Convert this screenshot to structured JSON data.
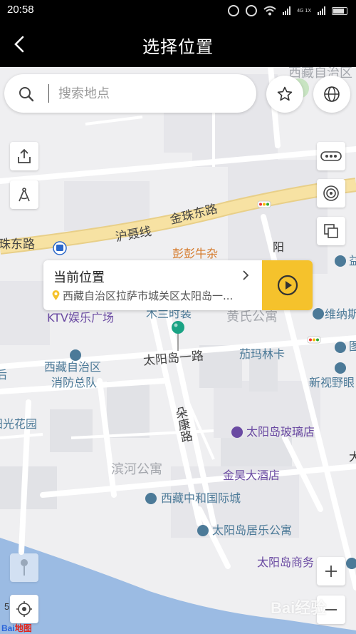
{
  "status_bar": {
    "time": "20:58",
    "network": "4G 1X"
  },
  "header": {
    "title": "选择位置"
  },
  "search": {
    "placeholder": "搜索地点"
  },
  "current_location": {
    "label": "当前位置",
    "address": "西藏自治区拉萨市城关区太阳岛一..."
  },
  "map": {
    "labels": {
      "tibet_region_top": "西藏自治区",
      "hu_nie_xian": "沪聂线",
      "jin_zhu_dong_lu_1": "金珠东路",
      "jin_zhu_dong_lu_2": "珠东路",
      "peng_peng": "彭彭牛杂",
      "yang_road": "阳",
      "ktv": "KTV娱乐广场",
      "mulan": "木兰时装",
      "huang_shi": "黄氏公寓",
      "weinaju": "维纳斯",
      "taiyangdao_yilu": "太阳岛一路",
      "qiemalinka": "茄玛林卡",
      "fire_station_1": "西藏自治区",
      "fire_station_2": "消防总队",
      "xinshi": "新视野眼",
      "guanghua": "阳光花园",
      "duokang": "朵康路",
      "glass_shop": "太阳岛玻璃店",
      "binhe": "滨河公寓",
      "jinhao": "金昊大酒店",
      "zhonghe": "西藏中和国际城",
      "juyue": "太阳岛居乐公寓",
      "shangwu": "太阳岛商务",
      "left_edge": "后",
      "right_edge_1": "益",
      "right_edge_2": "图",
      "right_edge_3": "大"
    }
  },
  "scale_text": "5",
  "logo": {
    "part1": "Bai",
    "part2": "地图"
  },
  "watermark": "Bai经验",
  "colors": {
    "accent_yellow": "#f5c22c",
    "pin_green": "#1aa384",
    "road_yellow": "#f7e2a3"
  }
}
